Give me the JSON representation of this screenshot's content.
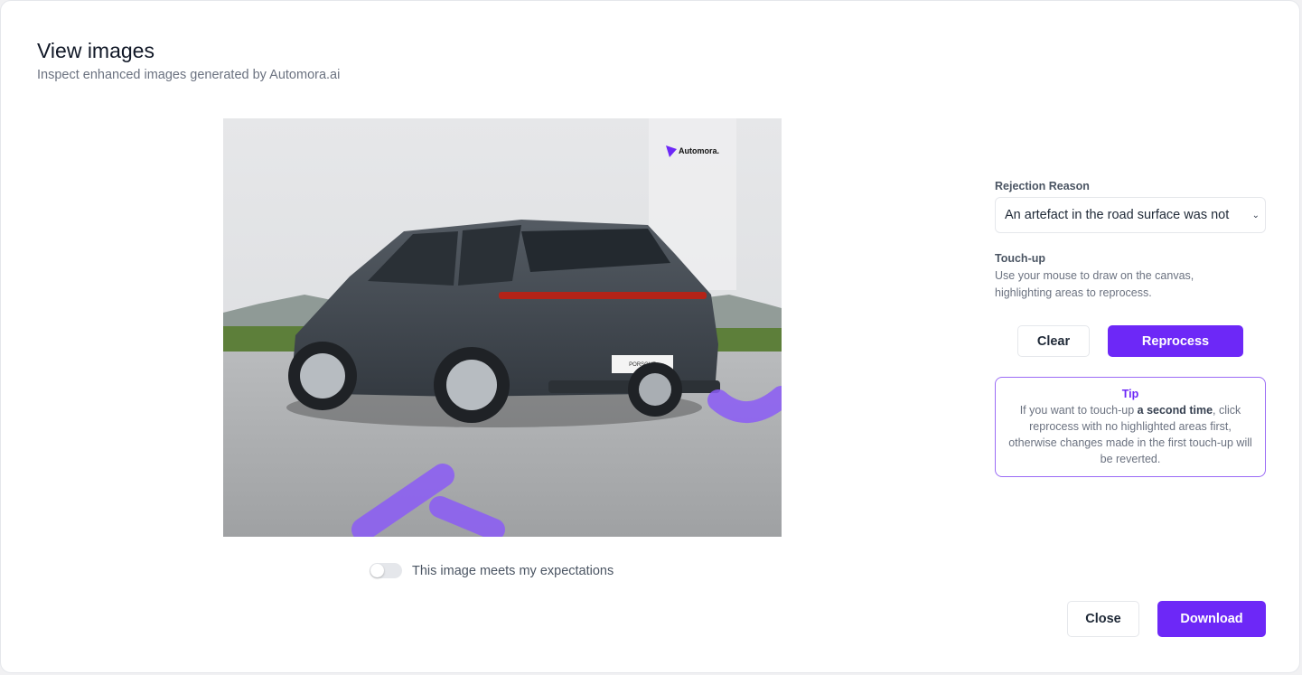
{
  "header": {
    "title": "View images",
    "subtitle": "Inspect enhanced images generated by Automora.ai"
  },
  "image": {
    "watermark_text": "Automora.",
    "plate_brand": "PORSCHE",
    "highlight_color": "#8b5cf6"
  },
  "toggle": {
    "label": "This image meets my expectations",
    "checked": false
  },
  "rejection": {
    "label": "Rejection Reason",
    "selected": "An artefact in the road surface was not"
  },
  "touchup": {
    "title": "Touch-up",
    "description": "Use your mouse to draw on the canvas, highlighting areas to reprocess.",
    "clear_label": "Clear",
    "reprocess_label": "Reprocess"
  },
  "tip": {
    "title": "Tip",
    "before": "If you want to touch-up ",
    "emphasis": "a second time",
    "after": ", click reprocess with no highlighted areas first, otherwise changes made in the first touch-up will be reverted."
  },
  "footer": {
    "close_label": "Close",
    "download_label": "Download"
  },
  "colors": {
    "accent": "#6d28f7",
    "tip_border": "#9b6cf5"
  }
}
